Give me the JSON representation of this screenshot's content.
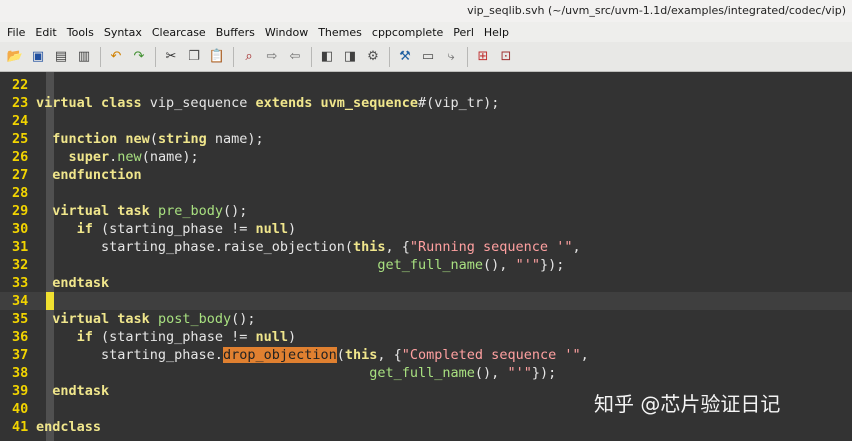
{
  "window": {
    "title": "vip_seqlib.svh (~/uvm_src/uvm-1.1d/examples/integrated/codec/vip)"
  },
  "menu": [
    "File",
    "Edit",
    "Tools",
    "Syntax",
    "Clearcase",
    "Buffers",
    "Window",
    "Themes",
    "cppcomplete",
    "Perl",
    "Help"
  ],
  "toolbar": {
    "icons": [
      "open-icon",
      "save-icon",
      "save-all-icon",
      "print-icon",
      "undo-icon",
      "redo-icon",
      "cut-icon",
      "copy-icon",
      "paste-icon",
      "find-icon",
      "find-next-icon",
      "find-prev-icon",
      "load-session-icon",
      "save-session-icon",
      "run-script-icon",
      "make-icon",
      "shell-icon",
      "tags-icon",
      "help-icon",
      "find-help-icon"
    ]
  },
  "colors": {
    "background": "#333333",
    "line_number": "#f2d400",
    "keyword": "#f0e68c",
    "string": "#ffa0a0",
    "function": "#a8e080",
    "highlight": "#e08030"
  },
  "code": {
    "current_line": 34,
    "lines": [
      {
        "n": "22",
        "parts": []
      },
      {
        "n": "23",
        "parts": [
          {
            "c": "kw",
            "t": "virtual class "
          },
          {
            "c": "txt",
            "t": "vip_sequence "
          },
          {
            "c": "kw",
            "t": "extends "
          },
          {
            "c": "ty",
            "t": "uvm_sequence"
          },
          {
            "c": "txt",
            "t": "#(vip_tr);"
          }
        ]
      },
      {
        "n": "24",
        "parts": []
      },
      {
        "n": "25",
        "parts": [
          {
            "c": "txt",
            "t": "  "
          },
          {
            "c": "kw",
            "t": "function "
          },
          {
            "c": "kw",
            "t": "new"
          },
          {
            "c": "txt",
            "t": "("
          },
          {
            "c": "kw",
            "t": "string "
          },
          {
            "c": "txt",
            "t": "name);"
          }
        ]
      },
      {
        "n": "26",
        "parts": [
          {
            "c": "txt",
            "t": "    "
          },
          {
            "c": "kw",
            "t": "super"
          },
          {
            "c": "txt",
            "t": "."
          },
          {
            "c": "fn",
            "t": "new"
          },
          {
            "c": "txt",
            "t": "(name);"
          }
        ]
      },
      {
        "n": "27",
        "parts": [
          {
            "c": "txt",
            "t": "  "
          },
          {
            "c": "kw",
            "t": "endfunction"
          }
        ]
      },
      {
        "n": "28",
        "parts": []
      },
      {
        "n": "29",
        "parts": [
          {
            "c": "txt",
            "t": "  "
          },
          {
            "c": "kw",
            "t": "virtual task "
          },
          {
            "c": "fn",
            "t": "pre_body"
          },
          {
            "c": "txt",
            "t": "();"
          }
        ]
      },
      {
        "n": "30",
        "parts": [
          {
            "c": "txt",
            "t": "     "
          },
          {
            "c": "kw",
            "t": "if "
          },
          {
            "c": "txt",
            "t": "(starting_phase != "
          },
          {
            "c": "kw",
            "t": "null"
          },
          {
            "c": "txt",
            "t": ")"
          }
        ]
      },
      {
        "n": "31",
        "parts": [
          {
            "c": "txt",
            "t": "        starting_phase.raise_objection("
          },
          {
            "c": "kw",
            "t": "this"
          },
          {
            "c": "txt",
            "t": ", {"
          },
          {
            "c": "str",
            "t": "\"Running sequence '\""
          },
          {
            "c": "txt",
            "t": ","
          }
        ]
      },
      {
        "n": "32",
        "parts": [
          {
            "c": "txt",
            "t": "                                          "
          },
          {
            "c": "fn",
            "t": "get_full_name"
          },
          {
            "c": "txt",
            "t": "(), "
          },
          {
            "c": "str",
            "t": "\"'\""
          },
          {
            "c": "txt",
            "t": "});"
          }
        ]
      },
      {
        "n": "33",
        "parts": [
          {
            "c": "txt",
            "t": "  "
          },
          {
            "c": "kw",
            "t": "endtask"
          }
        ]
      },
      {
        "n": "34",
        "parts": []
      },
      {
        "n": "35",
        "parts": [
          {
            "c": "txt",
            "t": "  "
          },
          {
            "c": "kw",
            "t": "virtual task "
          },
          {
            "c": "fn",
            "t": "post_body"
          },
          {
            "c": "txt",
            "t": "();"
          }
        ]
      },
      {
        "n": "36",
        "parts": [
          {
            "c": "txt",
            "t": "     "
          },
          {
            "c": "kw",
            "t": "if "
          },
          {
            "c": "txt",
            "t": "(starting_phase != "
          },
          {
            "c": "kw",
            "t": "null"
          },
          {
            "c": "txt",
            "t": ")"
          }
        ]
      },
      {
        "n": "37",
        "parts": [
          {
            "c": "txt",
            "t": "        starting_phase."
          },
          {
            "c": "hl",
            "t": "drop_objection"
          },
          {
            "c": "txt",
            "t": "("
          },
          {
            "c": "kw",
            "t": "this"
          },
          {
            "c": "txt",
            "t": ", {"
          },
          {
            "c": "str",
            "t": "\"Completed sequence '\""
          },
          {
            "c": "txt",
            "t": ","
          }
        ]
      },
      {
        "n": "38",
        "parts": [
          {
            "c": "txt",
            "t": "                                         "
          },
          {
            "c": "fn",
            "t": "get_full_name"
          },
          {
            "c": "txt",
            "t": "(), "
          },
          {
            "c": "str",
            "t": "\"'\""
          },
          {
            "c": "txt",
            "t": "});"
          }
        ]
      },
      {
        "n": "39",
        "parts": [
          {
            "c": "txt",
            "t": "  "
          },
          {
            "c": "kw",
            "t": "endtask"
          }
        ]
      },
      {
        "n": "40",
        "parts": []
      },
      {
        "n": "41",
        "parts": [
          {
            "c": "kw",
            "t": "endclass"
          }
        ]
      }
    ]
  },
  "watermark": "知乎 @芯片验证日记"
}
